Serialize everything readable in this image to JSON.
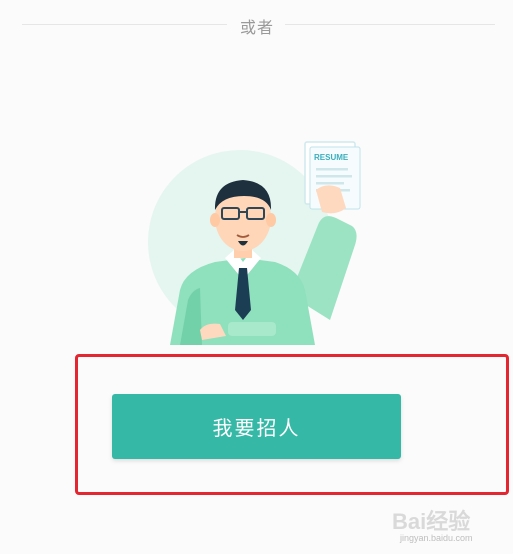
{
  "divider": {
    "text": "或者"
  },
  "illustration": {
    "resume_label": "RESUME"
  },
  "actions": {
    "recruit_label": "我要招人"
  },
  "watermark": {
    "logo_text": "Bai经验",
    "url": "jingyan.baidu.com"
  },
  "colors": {
    "primary": "#35b8a6",
    "highlight": "#e3262f",
    "divider_text": "#9a9a9a"
  }
}
